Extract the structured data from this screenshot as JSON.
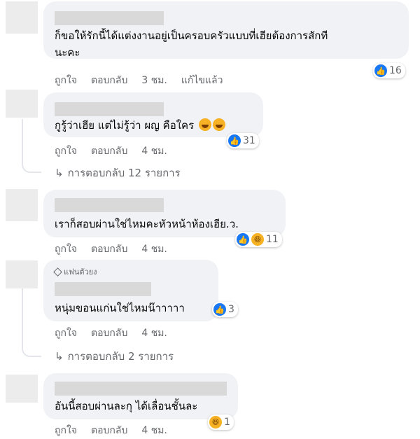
{
  "comments": [
    {
      "text_lines": [
        "ก็ขอให้รักนี้ได้แต่งงานอยู่เป็นครอบครัวแบบที่เฮียต้องการสักที",
        "นะคะ"
      ],
      "like_label": "ถูกใจ",
      "reply_label": "ตอบกลับ",
      "time": "3 ชม.",
      "edited": "แก้ไขแล้ว",
      "reaction_count": "16",
      "reaction_icons": [
        "like-icon"
      ]
    },
    {
      "text": "กูรู้ว่าเฮีย แต่ไม่รู้ว่า ผญ คือใคร",
      "emoji": [
        "laughing-emoji",
        "laughing-emoji"
      ],
      "like_label": "ถูกใจ",
      "reply_label": "ตอบกลับ",
      "time": "4 ชม.",
      "reaction_count": "31",
      "reaction_icons": [
        "like-icon"
      ],
      "replies": "การตอบกลับ 12 รายการ"
    },
    {
      "text": "เราก็สอบผ่านใช่ไหมคะหัวหน้าห้องเฮีย.ว.",
      "like_label": "ถูกใจ",
      "reply_label": "ตอบกลับ",
      "time": "4 ชม.",
      "reaction_count": "11",
      "reaction_icons": [
        "like-icon",
        "haha-icon"
      ]
    },
    {
      "badge": "แฟนตัวยง",
      "text": "หนุ่มขอนแก่นใช่ไหมน๊าาาาา",
      "like_label": "ถูกใจ",
      "reply_label": "ตอบกลับ",
      "time": "4 ชม.",
      "reaction_count": "3",
      "reaction_icons": [
        "like-icon"
      ],
      "replies": "การตอบกลับ 2 รายการ"
    },
    {
      "text": "อันนี้สอบผ่านละกุ ได้เลื่อนชั้นละ",
      "like_label": "ถูกใจ",
      "reply_label": "ตอบกลับ",
      "time": "4 ชม.",
      "reaction_count": "1",
      "reaction_icons": [
        "haha-icon"
      ]
    }
  ],
  "colors": {
    "bubble": "#f0f2f5",
    "meta_text": "#65676b",
    "like_blue": "#1877f2",
    "haha_yellow": "#f7b125"
  }
}
